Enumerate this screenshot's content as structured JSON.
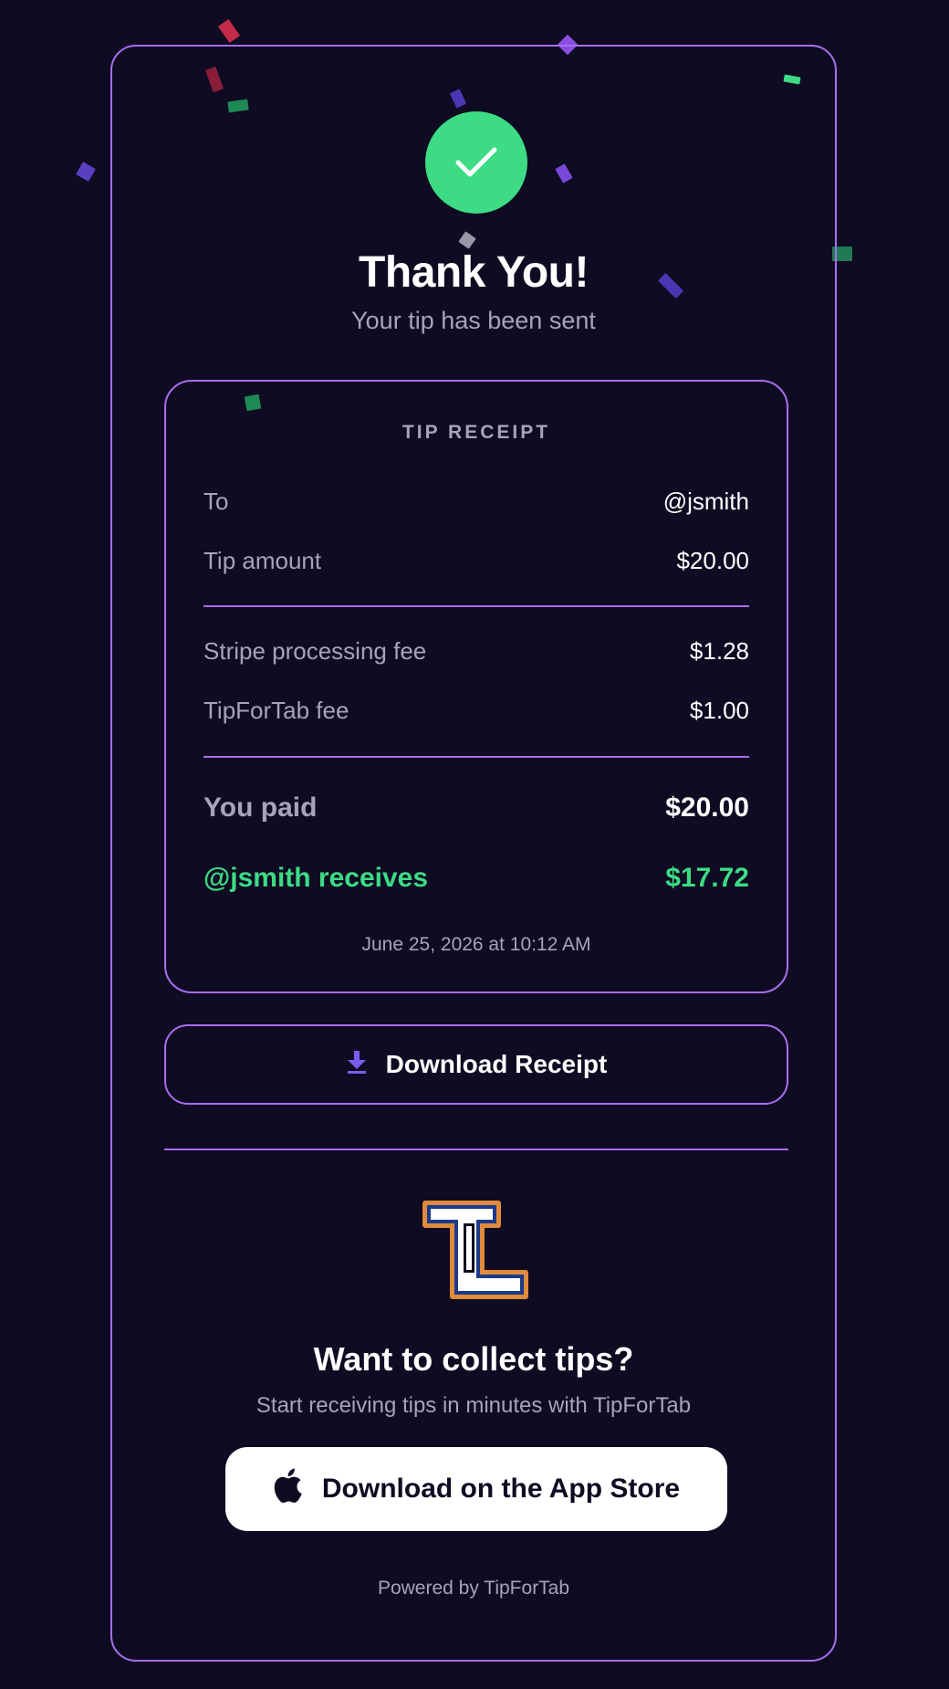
{
  "colors": {
    "background": "#0e0b22",
    "accent_border": "#a86ef0",
    "success_green": "#3ddc84",
    "muted_text": "#a7a4b8",
    "icon_purple": "#7a5cf0"
  },
  "header": {
    "icon": "check-icon",
    "title": "Thank You!",
    "subtitle": "Your tip has been sent"
  },
  "receipt": {
    "heading": "TIP RECEIPT",
    "to_label": "To",
    "to_value": "@jsmith",
    "tip_label": "Tip amount",
    "tip_value": "$20.00",
    "stripe_label": "Stripe processing fee",
    "stripe_value": "$1.28",
    "platform_label": "TipForTab fee",
    "platform_value": "$1.00",
    "paid_label": "You paid",
    "paid_value": "$20.00",
    "receives_label": "@jsmith receives",
    "receives_value": "$17.72",
    "timestamp": "June 25, 2026 at 10:12 AM"
  },
  "actions": {
    "download_icon": "download-icon",
    "download_label": "Download Receipt"
  },
  "promo": {
    "logo_icon": "tipfortab-logo",
    "title": "Want to collect tips?",
    "subtitle": "Start receiving tips in minutes with TipForTab",
    "app_icon": "apple-icon",
    "app_store_label": "Download on the App Store"
  },
  "footer": {
    "powered_by": "Powered by TipForTab"
  }
}
